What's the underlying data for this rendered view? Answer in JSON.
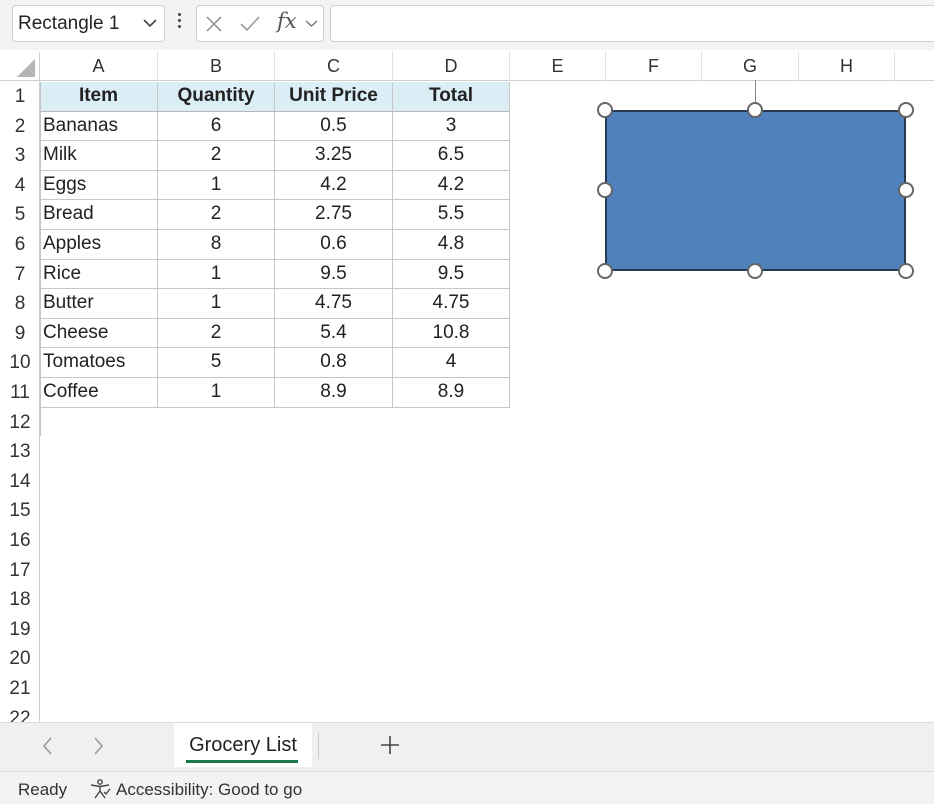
{
  "formula_bar": {
    "name_box": "Rectangle 1",
    "formula": ""
  },
  "columns": [
    "A",
    "B",
    "C",
    "D",
    "E",
    "F",
    "G",
    "H"
  ],
  "rows": [
    "1",
    "2",
    "3",
    "4",
    "5",
    "6",
    "7",
    "8",
    "9",
    "10",
    "11",
    "12",
    "13",
    "14",
    "15",
    "16",
    "17",
    "18",
    "19",
    "20",
    "21",
    "22"
  ],
  "table": {
    "headers": [
      "Item",
      "Quantity",
      "Unit Price",
      "Total"
    ],
    "rows": [
      [
        "Bananas",
        "6",
        "0.5",
        "3"
      ],
      [
        "Milk",
        "2",
        "3.25",
        "6.5"
      ],
      [
        "Eggs",
        "1",
        "4.2",
        "4.2"
      ],
      [
        "Bread",
        "2",
        "2.75",
        "5.5"
      ],
      [
        "Apples",
        "8",
        "0.6",
        "4.8"
      ],
      [
        "Rice",
        "1",
        "9.5",
        "9.5"
      ],
      [
        "Butter",
        "1",
        "4.75",
        "4.75"
      ],
      [
        "Cheese",
        "2",
        "5.4",
        "10.8"
      ],
      [
        "Tomatoes",
        "5",
        "0.8",
        "4"
      ],
      [
        "Coffee",
        "1",
        "8.9",
        "8.9"
      ]
    ]
  },
  "shape": {
    "name": "Rectangle 1",
    "fill_color": "#4f81bd",
    "border_color": "#263a52"
  },
  "sheet_tabs": {
    "active": "Grocery List"
  },
  "status_bar": {
    "ready": "Ready",
    "accessibility": "Accessibility: Good to go"
  },
  "colors": {
    "header_fill": "#dbeef5",
    "tab_accent": "#1d7a46"
  }
}
